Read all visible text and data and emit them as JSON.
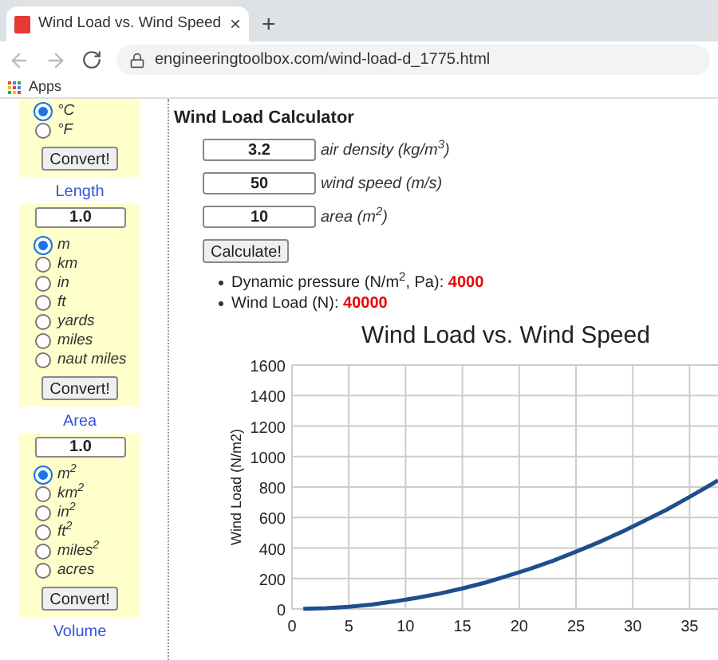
{
  "browser": {
    "tab": {
      "title": "Wind Load vs. Wind Speed",
      "close": "×"
    },
    "new_tab": "+",
    "url": "engineeringtoolbox.com/wind-load-d_1775.html",
    "bookmarks": [
      {
        "label": "Apps"
      }
    ]
  },
  "sidebar": {
    "panels": [
      {
        "options": [
          {
            "label": "°C",
            "selected": true
          },
          {
            "label": "°F",
            "selected": false
          }
        ],
        "button": "Convert!"
      },
      {
        "heading": "Length",
        "value": "1.0",
        "options": [
          {
            "label": "m",
            "selected": true
          },
          {
            "label": "km",
            "selected": false
          },
          {
            "label": "in",
            "selected": false
          },
          {
            "label": "ft",
            "selected": false
          },
          {
            "label": "yards",
            "selected": false
          },
          {
            "label": "miles",
            "selected": false
          },
          {
            "label": "naut miles",
            "selected": false
          }
        ],
        "button": "Convert!"
      },
      {
        "heading": "Area",
        "value": "1.0",
        "options": [
          {
            "label": "m$^{2}$",
            "selected": true
          },
          {
            "label": "km$^{2}$",
            "selected": false
          },
          {
            "label": "in$^{2}$",
            "selected": false
          },
          {
            "label": "ft$^{2}$",
            "selected": false
          },
          {
            "label": "miles$^{2}$",
            "selected": false
          },
          {
            "label": "acres",
            "selected": false
          }
        ],
        "button": "Convert!"
      }
    ],
    "next_heading": "Volume"
  },
  "main": {
    "title": "Wind Load Calculator",
    "fields": [
      {
        "value": "3.2",
        "label": "air density (kg/m$^{3}$)"
      },
      {
        "value": "50",
        "label": "wind speed (m/s)"
      },
      {
        "value": "10",
        "label": "area (m$^{2}$)"
      }
    ],
    "button": "Calculate!",
    "results": [
      {
        "label": "Dynamic pressure (N/m$^{2}$, Pa): ",
        "value": "4000"
      },
      {
        "label": "Wind Load (N): ",
        "value": "40000"
      }
    ],
    "chart_data": {
      "type": "line",
      "title": "Wind Load vs. Wind Speed",
      "ylabel": "Wind Load (N/m2)",
      "x": [
        1,
        3,
        5,
        7,
        9,
        11,
        13,
        15,
        17,
        19,
        21,
        23,
        25,
        27,
        29,
        31,
        33,
        35,
        37,
        37.5
      ],
      "series": [
        {
          "color": "#1f4e8c",
          "values": [
            1,
            5,
            15,
            29,
            49,
            73,
            101,
            135,
            173,
            217,
            265,
            317,
            375,
            437,
            505,
            577,
            653,
            735,
            821,
            844
          ]
        }
      ],
      "grid": true,
      "xlim": [
        0,
        37.5
      ],
      "ylim": [
        0,
        1600
      ],
      "xticks": [
        0,
        5,
        10,
        15,
        20,
        25,
        30,
        35
      ],
      "yticks": [
        0,
        200,
        400,
        600,
        800,
        1000,
        1200,
        1400,
        1600
      ]
    }
  }
}
